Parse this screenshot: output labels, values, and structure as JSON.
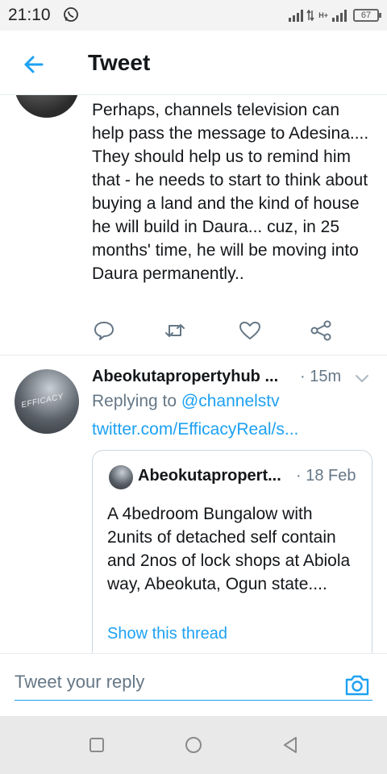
{
  "status_bar": {
    "time": "21:10",
    "network_label": "H+",
    "battery": "67",
    "icons": [
      "whatsapp-icon",
      "signal-icon",
      "battery-icon"
    ]
  },
  "header": {
    "title": "Tweet",
    "back_icon": "arrow-left-icon"
  },
  "tweets": [
    {
      "text": "Perhaps, channels television can help pass the message to Adesina.... They should help us to remind him that - he needs to start to think about buying a land and the kind of house he will build in Daura... cuz, in 25 months' time, he will be moving into Daura permanently..",
      "actions": [
        "reply-icon",
        "retweet-icon",
        "like-icon",
        "share-icon"
      ]
    },
    {
      "author": "Abeokutapropertyhub ...",
      "time": "· 15m",
      "replying_prefix": "Replying to ",
      "replying_to": "@channelstv",
      "link": "twitter.com/EfficacyReal/s...",
      "avatar_text": "EFFICACY",
      "quote": {
        "author": "Abeokutapropert...",
        "time": "· 18 Feb",
        "text": "A 4bedroom Bungalow with 2units of detached self contain and 2nos of lock shops at Abiola way, Abeokuta, Ogun state....",
        "show_thread": "Show this thread"
      }
    }
  ],
  "reply_bar": {
    "placeholder": "Tweet your reply",
    "camera_icon": "camera-icon"
  },
  "nav_bar": {
    "buttons": [
      "recent-apps-icon",
      "home-icon",
      "back-triangle-icon"
    ]
  },
  "colors": {
    "accent": "#1da1f2",
    "text": "#14171a",
    "secondary": "#657786",
    "divider": "#e6ecf0"
  }
}
